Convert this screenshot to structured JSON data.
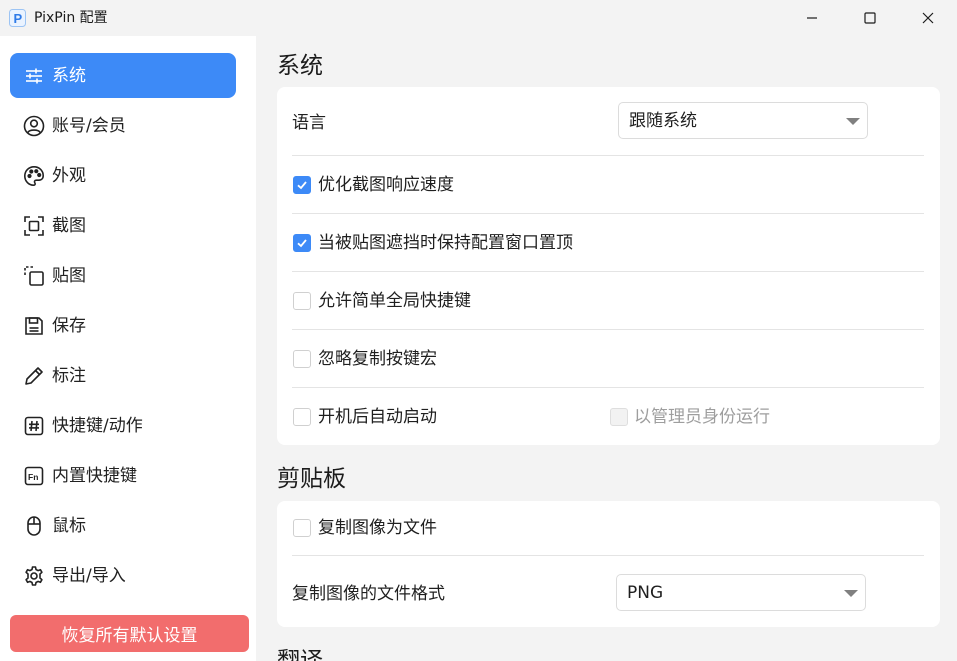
{
  "window": {
    "title": "PixPin 配置",
    "logo_letter": "P"
  },
  "sidebar": {
    "items": [
      {
        "label": "系统",
        "icon": "sliders-icon",
        "active": true
      },
      {
        "label": "账号/会员",
        "icon": "user-circle-icon"
      },
      {
        "label": "外观",
        "icon": "palette-icon"
      },
      {
        "label": "截图",
        "icon": "screenshot-icon"
      },
      {
        "label": "贴图",
        "icon": "pin-image-icon"
      },
      {
        "label": "保存",
        "icon": "floppy-disk-icon"
      },
      {
        "label": "标注",
        "icon": "pencil-icon"
      },
      {
        "label": "快捷键/动作",
        "icon": "hash-key-icon"
      },
      {
        "label": "内置快捷键",
        "icon": "fn-key-icon"
      },
      {
        "label": "鼠标",
        "icon": "mouse-icon"
      },
      {
        "label": "导出/导入",
        "icon": "gear-icon"
      }
    ],
    "reset_label": "恢复所有默认设置"
  },
  "system": {
    "title": "系统",
    "language_label": "语言",
    "language_value": "跟随系统",
    "options": [
      {
        "label": "优化截图响应速度",
        "checked": true
      },
      {
        "label": "当被贴图遮挡时保持配置窗口置顶",
        "checked": true
      },
      {
        "label": "允许简单全局快捷键",
        "checked": false
      },
      {
        "label": "忽略复制按键宏",
        "checked": false
      },
      {
        "label": "开机后自动启动",
        "checked": false
      }
    ],
    "run_as_admin": {
      "label": "以管理员身份运行",
      "checked": false,
      "disabled": true
    }
  },
  "clipboard": {
    "title": "剪贴板",
    "copy_as_file": {
      "label": "复制图像为文件",
      "checked": false
    },
    "format_label": "复制图像的文件格式",
    "format_value": "PNG"
  },
  "translate": {
    "title": "翻译"
  },
  "colors": {
    "accent": "#3d8af7",
    "danger": "#f26d6d"
  }
}
